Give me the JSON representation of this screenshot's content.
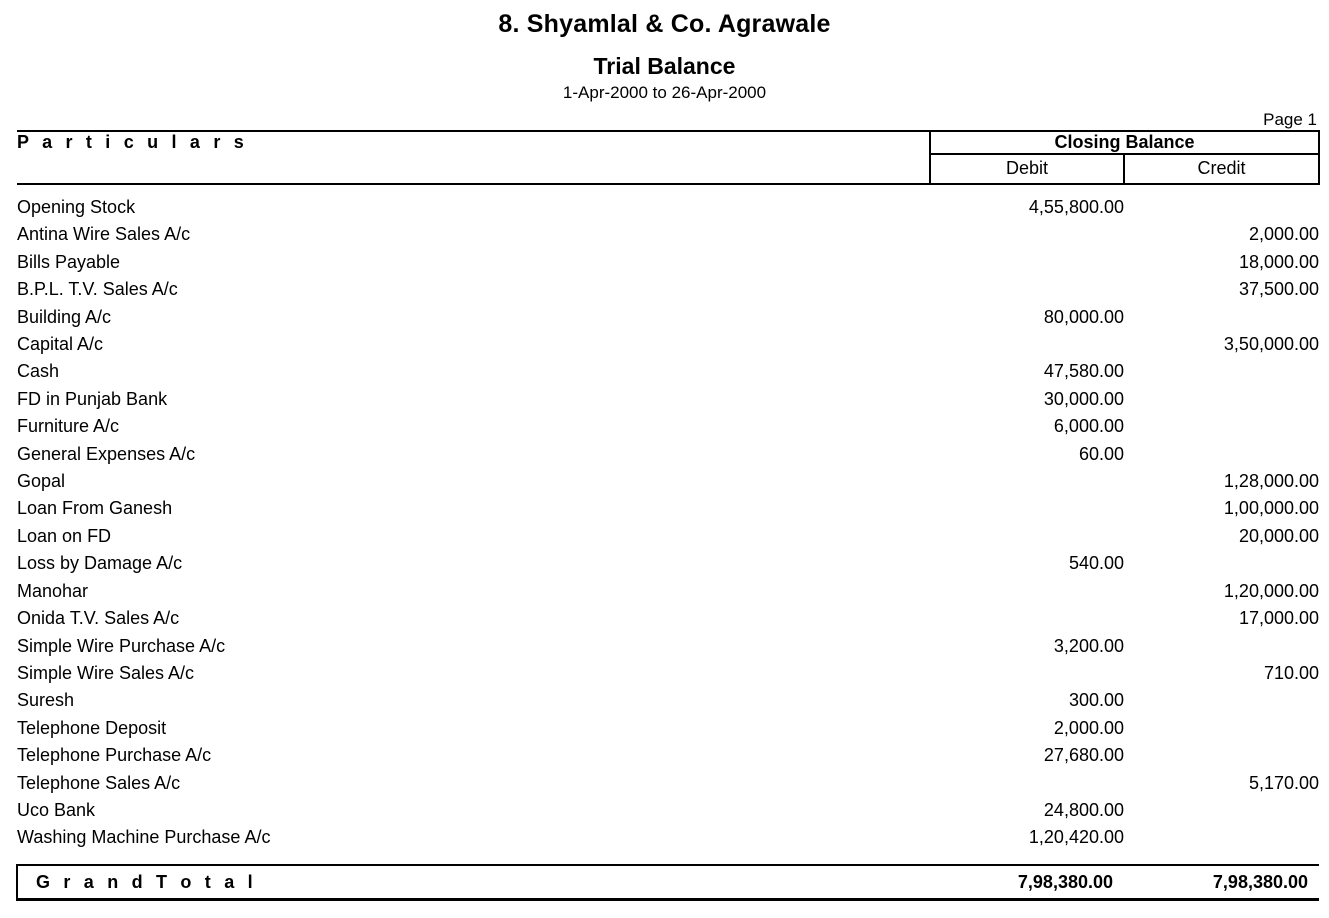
{
  "report": {
    "company_name": "8. Shyamlal & Co. Agrawale",
    "title": "Trial Balance",
    "period": "1-Apr-2000 to 26-Apr-2000",
    "page_label": "Page 1"
  },
  "table": {
    "headers": {
      "particulars": "P a r t i c u l a r s",
      "group": "Closing Balance",
      "debit": "Debit",
      "credit": "Credit"
    },
    "rows": [
      {
        "particular": "Opening Stock",
        "debit": "4,55,800.00",
        "credit": ""
      },
      {
        "particular": "Antina Wire Sales A/c",
        "debit": "",
        "credit": "2,000.00"
      },
      {
        "particular": "Bills Payable",
        "debit": "",
        "credit": "18,000.00"
      },
      {
        "particular": "B.P.L. T.V. Sales A/c",
        "debit": "",
        "credit": "37,500.00"
      },
      {
        "particular": "Building A/c",
        "debit": "80,000.00",
        "credit": ""
      },
      {
        "particular": "Capital A/c",
        "debit": "",
        "credit": "3,50,000.00"
      },
      {
        "particular": "Cash",
        "debit": "47,580.00",
        "credit": ""
      },
      {
        "particular": "FD in Punjab Bank",
        "debit": "30,000.00",
        "credit": ""
      },
      {
        "particular": "Furniture A/c",
        "debit": "6,000.00",
        "credit": ""
      },
      {
        "particular": "General Expenses A/c",
        "debit": "60.00",
        "credit": ""
      },
      {
        "particular": "Gopal",
        "debit": "",
        "credit": "1,28,000.00"
      },
      {
        "particular": "Loan From Ganesh",
        "debit": "",
        "credit": "1,00,000.00"
      },
      {
        "particular": "Loan on FD",
        "debit": "",
        "credit": "20,000.00"
      },
      {
        "particular": "Loss by Damage A/c",
        "debit": "540.00",
        "credit": ""
      },
      {
        "particular": "Manohar",
        "debit": "",
        "credit": "1,20,000.00"
      },
      {
        "particular": "Onida T.V. Sales A/c",
        "debit": "",
        "credit": "17,000.00"
      },
      {
        "particular": "Simple Wire Purchase A/c",
        "debit": "3,200.00",
        "credit": ""
      },
      {
        "particular": "Simple Wire Sales A/c",
        "debit": "",
        "credit": "710.00"
      },
      {
        "particular": "Suresh",
        "debit": "300.00",
        "credit": ""
      },
      {
        "particular": "Telephone Deposit",
        "debit": "2,000.00",
        "credit": ""
      },
      {
        "particular": "Telephone Purchase A/c",
        "debit": "27,680.00",
        "credit": ""
      },
      {
        "particular": "Telephone Sales A/c",
        "debit": "",
        "credit": "5,170.00"
      },
      {
        "particular": "Uco Bank",
        "debit": "24,800.00",
        "credit": ""
      },
      {
        "particular": "Washing Machine Purchase A/c",
        "debit": "1,20,420.00",
        "credit": ""
      }
    ],
    "grand_total": {
      "label": "G r a n d   T o t a l",
      "debit": "7,98,380.00",
      "credit": "7,98,380.00"
    }
  }
}
